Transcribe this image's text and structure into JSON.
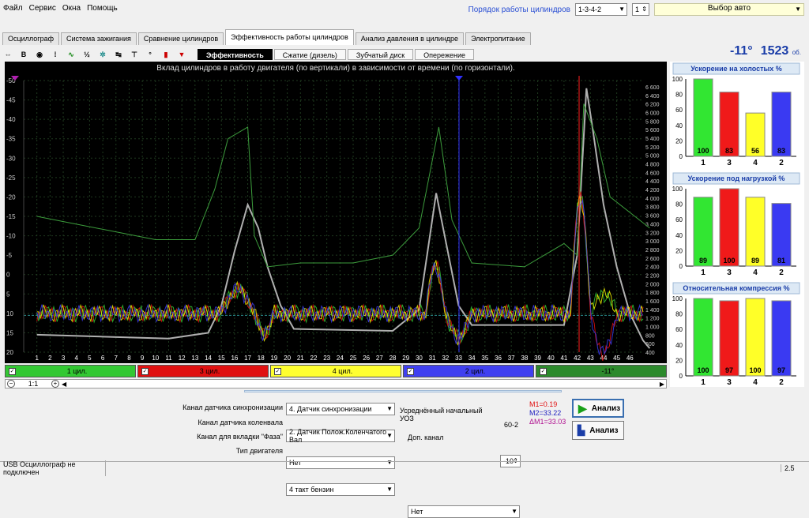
{
  "menu": [
    "Файл",
    "Сервис",
    "Окна",
    "Помощь"
  ],
  "top": {
    "order_label": "Порядок работы цилиндров",
    "order_value": "1-3-4-2",
    "cyl_num": "1",
    "car_select": "Выбор авто"
  },
  "main_tabs": [
    {
      "label": "Осциллограф",
      "active": false
    },
    {
      "label": "Система зажигания",
      "active": false
    },
    {
      "label": "Сравнение цилиндров",
      "active": false
    },
    {
      "label": "Эффективность работы цилиндров",
      "active": true
    },
    {
      "label": "Анализ давления в цилиндре",
      "active": false
    },
    {
      "label": "Электропитание",
      "active": false
    }
  ],
  "sub_tabs": [
    {
      "label": "Эффективность",
      "active": true
    },
    {
      "label": "Сжатие (дизель)",
      "active": false
    },
    {
      "label": "Зубчатый диск",
      "active": false
    },
    {
      "label": "Опережение",
      "active": false
    }
  ],
  "readout": {
    "angle": "-11°",
    "rpm": "1523",
    "rpm_unit": "об."
  },
  "chart_data": {
    "type": "line",
    "title": "Вклад цилиндров в работу двигателя (по вертикали) в зависимости от времени (по горизонтали).",
    "left_axis_ticks": [
      "-50",
      "-45",
      "-40",
      "-35",
      "-30",
      "-25",
      "-20",
      "-15",
      "-10",
      "-5",
      "0",
      "5",
      "10",
      "15",
      "20"
    ],
    "right_axis_ticks": [
      "6 600",
      "6 400",
      "6 200",
      "6 000",
      "5 800",
      "5 600",
      "5 400",
      "5 200",
      "5 000",
      "4 800",
      "4 600",
      "4 400",
      "4 200",
      "4 000",
      "3 800",
      "3 600",
      "3 400",
      "3 200",
      "3 000",
      "2 800",
      "2 600",
      "2 400",
      "2 200",
      "2 000",
      "1 800",
      "1 600",
      "1 400",
      "1 200",
      "1 000",
      "800",
      "600",
      "400"
    ],
    "x_ticks": [
      "1",
      "2",
      "3",
      "4",
      "5",
      "6",
      "7",
      "8",
      "9",
      "10",
      "11",
      "12",
      "13",
      "14",
      "15",
      "16",
      "17",
      "18",
      "19",
      "20",
      "21",
      "22",
      "23",
      "24",
      "25",
      "26",
      "27",
      "28",
      "29",
      "30",
      "31",
      "32",
      "33",
      "34",
      "35",
      "36",
      "37",
      "38",
      "39",
      "40",
      "41",
      "42",
      "43",
      "44",
      "45",
      "46"
    ],
    "ylim": [
      -50,
      20
    ],
    "grid": true,
    "series": [
      {
        "name": "1 цил.",
        "color": "#32c832"
      },
      {
        "name": "3 цил.",
        "color": "#e01010"
      },
      {
        "name": "4 цил.",
        "color": "#f0f000"
      },
      {
        "name": "2 цил.",
        "color": "#3c3cf0"
      }
    ]
  },
  "channels": [
    {
      "label": "1 цил.",
      "color": "#32c832"
    },
    {
      "label": "3 цил.",
      "color": "#e01010"
    },
    {
      "label": "4 цил.",
      "color": "#ffff30"
    },
    {
      "label": "2 цил.",
      "color": "#4040f0"
    },
    {
      "label": "-11°",
      "color": "#2c8a2c"
    }
  ],
  "zoom_label": "1:1",
  "panels": [
    {
      "title": "Ускорение на холостых %",
      "ticks": [
        "100",
        "80",
        "60",
        "40",
        "20",
        "0"
      ],
      "bars": [
        {
          "cyl": "1",
          "value": 100,
          "label": "100",
          "color": "#32e632"
        },
        {
          "cyl": "3",
          "value": 83,
          "label": "83",
          "color": "#f01a1a"
        },
        {
          "cyl": "4",
          "value": 56,
          "label": "56",
          "color": "#ffff28"
        },
        {
          "cyl": "2",
          "value": 83,
          "label": "83",
          "color": "#3a3af2"
        }
      ]
    },
    {
      "title": "Ускорение под нагрузкой %",
      "ticks": [
        "100",
        "80",
        "60",
        "40",
        "20",
        "0"
      ],
      "bars": [
        {
          "cyl": "1",
          "value": 89,
          "label": "89",
          "color": "#32e632"
        },
        {
          "cyl": "3",
          "value": 100,
          "label": "100",
          "color": "#f01a1a"
        },
        {
          "cyl": "4",
          "value": 89,
          "label": "89",
          "color": "#ffff28"
        },
        {
          "cyl": "2",
          "value": 81,
          "label": "81",
          "color": "#3a3af2"
        }
      ]
    },
    {
      "title": "Относительная компрессия %",
      "ticks": [
        "100",
        "80",
        "60",
        "40",
        "20",
        "0"
      ],
      "bars": [
        {
          "cyl": "1",
          "value": 100,
          "label": "100",
          "color": "#32e632"
        },
        {
          "cyl": "3",
          "value": 97,
          "label": "97",
          "color": "#f01a1a"
        },
        {
          "cyl": "4",
          "value": 100,
          "label": "100",
          "color": "#ffff28"
        },
        {
          "cyl": "2",
          "value": 97,
          "label": "97",
          "color": "#3a3af2"
        }
      ]
    }
  ],
  "settings": {
    "sync_label": "Канал датчика синхронизации",
    "sync_value": "4. Датчик синхронизации",
    "crank_label": "Канал датчика коленвала",
    "crank_value": "2. Датчик Полож.Коленчатого Вал",
    "phase_label": "Канал для вкладки \"Фаза\"",
    "phase_value": "Нет",
    "engine_label": "Тип двигателя",
    "engine_value": "4 такт бензин",
    "uoz_label": "Усреднённый начальный УОЗ",
    "uoz_value": "-10",
    "disk_label": "60-2",
    "extra_label": "Доп. канал",
    "extra_value": "Нет",
    "m1": "M1=0.19",
    "m2": "M2=33.22",
    "dm": "ΔM1=33.03",
    "run1": "Анализ",
    "run2": "Анализ"
  },
  "status": {
    "left": "USB Осциллограф не подключен",
    "right": "2.5"
  }
}
